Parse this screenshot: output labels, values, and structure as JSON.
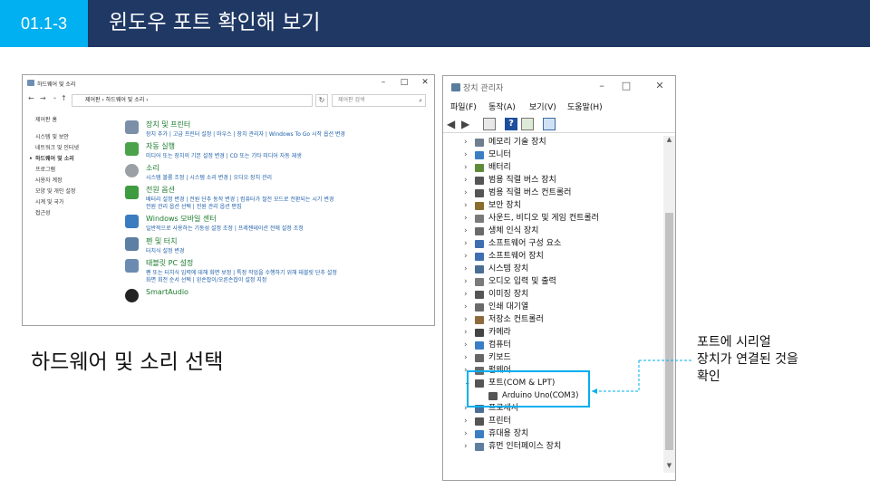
{
  "header": {
    "badge": "01.1-3",
    "title": "윈도우 포트 확인해 보기",
    "bg_color": "#1f3864",
    "badge_color": "#00b0f0"
  },
  "control_panel": {
    "title": "하드웨어 및 소리",
    "address": "제어판 › 하드웨어 및 소리 ›",
    "search_placeholder": "제어판 검색",
    "sidebar": [
      "제어판 홈",
      "시스템 및 보안",
      "네트워크 및 인터넷",
      "하드웨어 및 소리",
      "프로그램",
      "사용자 계정",
      "모양 및 개인 설정",
      "시계 및 국가",
      "접근성"
    ],
    "sidebar_selected": "하드웨어 및 소리",
    "sections": [
      {
        "heading": "장치 및 프린터",
        "icon": "printer-icon",
        "links": [
          "장치 추가 | 고급 프린터 설정 | 마우스 | 장치 관리자 | Windows To Go 시작 옵션 변경"
        ]
      },
      {
        "heading": "자동 실행",
        "icon": "autoplay-icon",
        "links": [
          "미디어 또는 장치의 기본 설정 변경 | CD 또는 기타 미디어 자동 재생"
        ]
      },
      {
        "heading": "소리",
        "icon": "speaker-icon",
        "links": [
          "시스템 볼륨 조정 | 시스템 소리 변경 | 오디오 장치 관리"
        ]
      },
      {
        "heading": "전원 옵션",
        "icon": "power-icon",
        "links": [
          "배터리 설정 변경 | 전원 단추 동작 변경 | 컴퓨터가 절전 모드로 전환되는 시기 변경",
          "전원 관리 옵션 선택 | 전원 관리 옵션 편집"
        ]
      },
      {
        "heading": "Windows 모바일 센터",
        "icon": "mobility-icon",
        "links": [
          "일반적으로 사용하는 기동성 설정 조정 | 프레젠테이션 전에 설정 조정"
        ]
      },
      {
        "heading": "펜 및 터치",
        "icon": "pen-icon",
        "links": [
          "터치식 설정 변경"
        ]
      },
      {
        "heading": "태블릿 PC 설정",
        "icon": "tablet-icon",
        "links": [
          "펜 또는 터치식 입력에 대해 화면 보정 | 특정 작업을 수행하기 위해 태블릿 단추 설정",
          "화면 회전 순서 선택 | 왼손잡이/오른손잡이 설정 지정"
        ]
      },
      {
        "heading": "SmartAudio",
        "icon": "smartaudio-icon",
        "links": []
      }
    ]
  },
  "device_manager": {
    "title": "장치 관리자",
    "menu": [
      "파일(F)",
      "동작(A)",
      "보기(V)",
      "도움말(H)"
    ],
    "items": [
      {
        "label": "메모리 기술 장치",
        "expanded": false
      },
      {
        "label": "모니터",
        "expanded": false
      },
      {
        "label": "배터리",
        "expanded": false
      },
      {
        "label": "범용 직렬 버스 장치",
        "expanded": false
      },
      {
        "label": "범용 직렬 버스 컨트롤러",
        "expanded": false
      },
      {
        "label": "보안 장치",
        "expanded": false
      },
      {
        "label": "사운드, 비디오 및 게임 컨트롤러",
        "expanded": false
      },
      {
        "label": "생체 인식 장치",
        "expanded": false
      },
      {
        "label": "소프트웨어 구성 요소",
        "expanded": false
      },
      {
        "label": "소프트웨어 장치",
        "expanded": false
      },
      {
        "label": "시스템 장치",
        "expanded": false
      },
      {
        "label": "오디오 입력 및 출력",
        "expanded": false
      },
      {
        "label": "이미징 장치",
        "expanded": false
      },
      {
        "label": "인쇄 대기열",
        "expanded": false
      },
      {
        "label": "저장소 컨트롤러",
        "expanded": false
      },
      {
        "label": "카메라",
        "expanded": false
      },
      {
        "label": "컴퓨터",
        "expanded": false
      },
      {
        "label": "키보드",
        "expanded": false
      },
      {
        "label": "펌웨어",
        "expanded": false
      },
      {
        "label": "포트(COM & LPT)",
        "expanded": true
      },
      {
        "label": "Arduino Uno(COM3)",
        "child": true
      },
      {
        "label": "프로세서",
        "expanded": false
      },
      {
        "label": "프린터",
        "expanded": false
      },
      {
        "label": "휴대용 장치",
        "expanded": false
      },
      {
        "label": "휴먼 인터페이스 장치",
        "expanded": false
      }
    ],
    "highlight_color": "#00aeef"
  },
  "callout": [
    "포트에 시리얼",
    "장치가 연결된 것을",
    "확인"
  ],
  "caption": "하드웨어 및 소리 선택"
}
